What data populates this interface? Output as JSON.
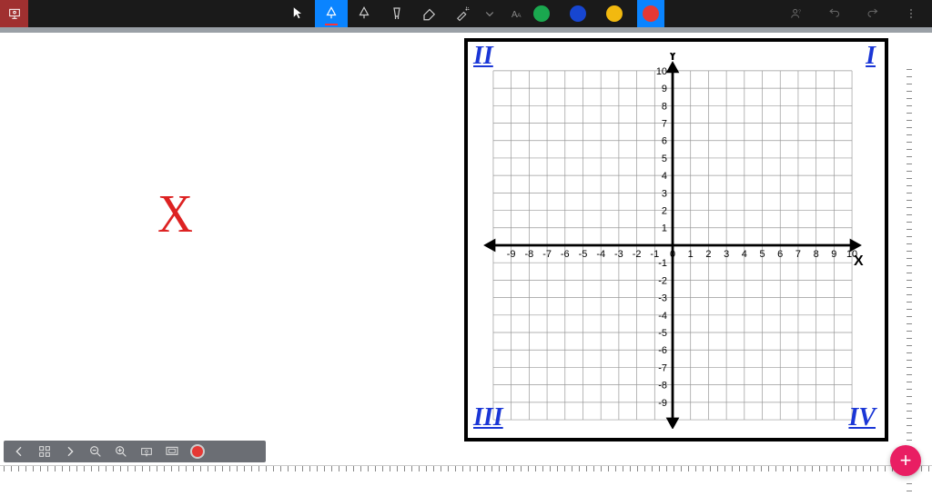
{
  "toolbar": {
    "tools": [
      {
        "id": "cursor",
        "name": "cursor-icon",
        "selected": false
      },
      {
        "id": "pen",
        "name": "pen-tool-icon",
        "selected": true,
        "accent": "#ff3333"
      },
      {
        "id": "pen-outline",
        "name": "triangle-pen-icon",
        "selected": false
      },
      {
        "id": "highlighter",
        "name": "highlighter-icon",
        "selected": false
      },
      {
        "id": "eraser",
        "name": "eraser-icon",
        "selected": false
      },
      {
        "id": "pointer",
        "name": "laser-pointer-icon",
        "selected": false
      },
      {
        "id": "more",
        "name": "chevron-down-icon",
        "selected": false
      },
      {
        "id": "text",
        "name": "text-tool-icon",
        "selected": false
      }
    ],
    "colors": [
      {
        "hex": "#1aa84f",
        "selected": false
      },
      {
        "hex": "#1746d1",
        "selected": false
      },
      {
        "hex": "#f2b90f",
        "selected": false
      },
      {
        "hex": "#e53935",
        "selected": true
      }
    ],
    "right": [
      {
        "name": "person-icon"
      },
      {
        "name": "undo-icon"
      },
      {
        "name": "redo-icon"
      },
      {
        "name": "more-vert-icon"
      }
    ]
  },
  "whiteboard": {
    "annotation_text": "X",
    "annotation_color": "#d22"
  },
  "chart_data": {
    "type": "coordinate-plane",
    "title": "",
    "x_axis_label": "X",
    "y_axis_label": "Y",
    "x_ticks": [
      -9,
      -8,
      -7,
      -6,
      -5,
      -4,
      -3,
      -2,
      -1,
      0,
      1,
      2,
      3,
      4,
      5,
      6,
      7,
      8,
      9,
      10
    ],
    "y_ticks": [
      -9,
      -8,
      -7,
      -6,
      -5,
      -4,
      -3,
      -2,
      -1,
      0,
      1,
      2,
      3,
      4,
      5,
      6,
      7,
      8,
      9,
      10
    ],
    "xlim": [
      -10,
      10
    ],
    "ylim": [
      -10,
      10
    ],
    "quadrants": [
      {
        "roman": "I",
        "x": "pos",
        "y": "pos"
      },
      {
        "roman": "II",
        "x": "neg",
        "y": "pos"
      },
      {
        "roman": "III",
        "x": "neg",
        "y": "neg"
      },
      {
        "roman": "IV",
        "x": "pos",
        "y": "neg"
      }
    ],
    "series": []
  },
  "bottombar": {
    "icons": [
      "prev-page",
      "page-grid",
      "next-page",
      "zoom-out",
      "zoom-in",
      "fit-width",
      "fit-screen",
      "record"
    ]
  },
  "fab": {
    "label": "+"
  }
}
